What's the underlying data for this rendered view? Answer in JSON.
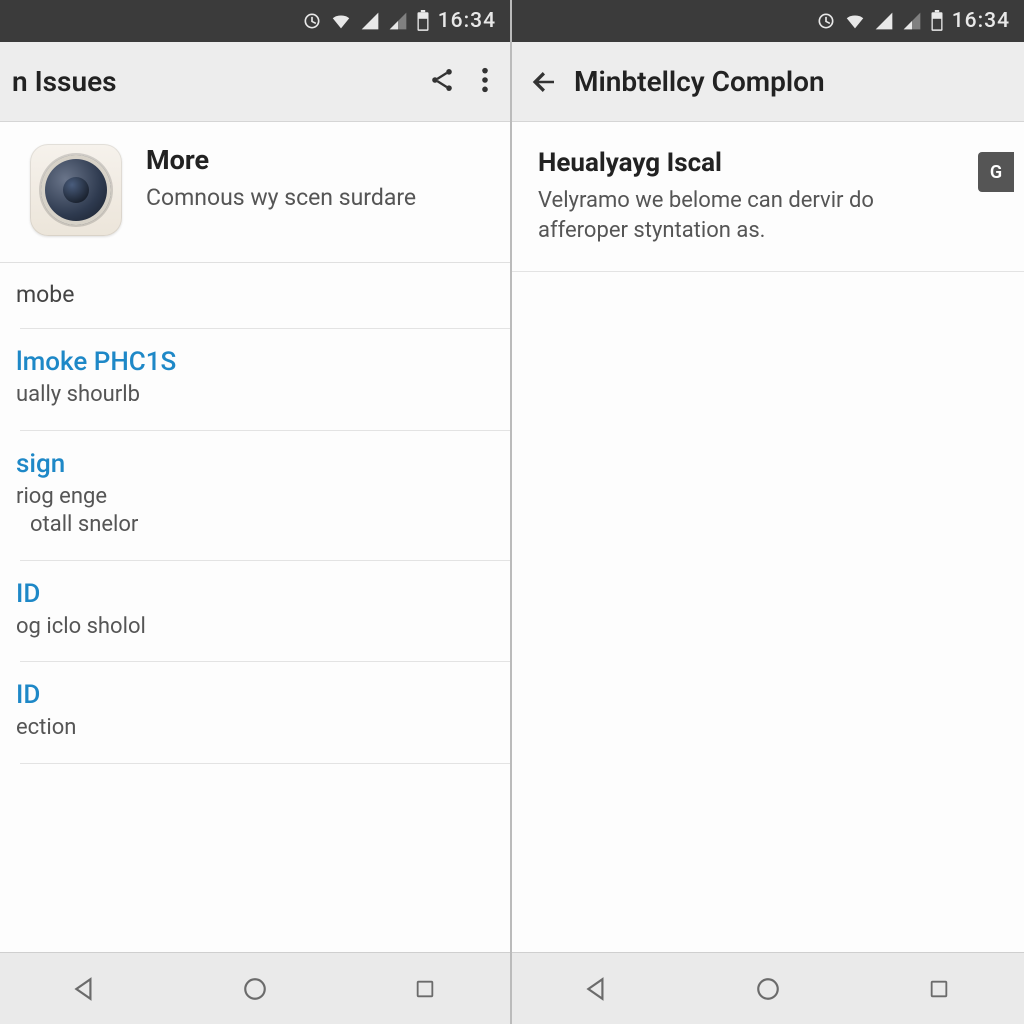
{
  "status": {
    "time": "16:34"
  },
  "left": {
    "appbar": {
      "title": "n Issues"
    },
    "header": {
      "title": "More",
      "subtitle": "Comnous wy scen surdare"
    },
    "items": [
      {
        "title": "mobe",
        "subtitle": "",
        "plain": true
      },
      {
        "title": "lmoke PHC1S",
        "subtitle": "ually shourlb"
      },
      {
        "title": "sign",
        "subtitle": "riog enge\notall snelor"
      },
      {
        "title": "ID",
        "subtitle": "og iclo sholol"
      },
      {
        "title": "ID",
        "subtitle": "ection"
      }
    ]
  },
  "right": {
    "appbar": {
      "title": "Minbtellcy Complon"
    },
    "setting": {
      "title": "Heualyayg Iscal",
      "subtitle": "Velyramo we belome can dervir do afferoper styntation as.",
      "badge": "G"
    }
  }
}
